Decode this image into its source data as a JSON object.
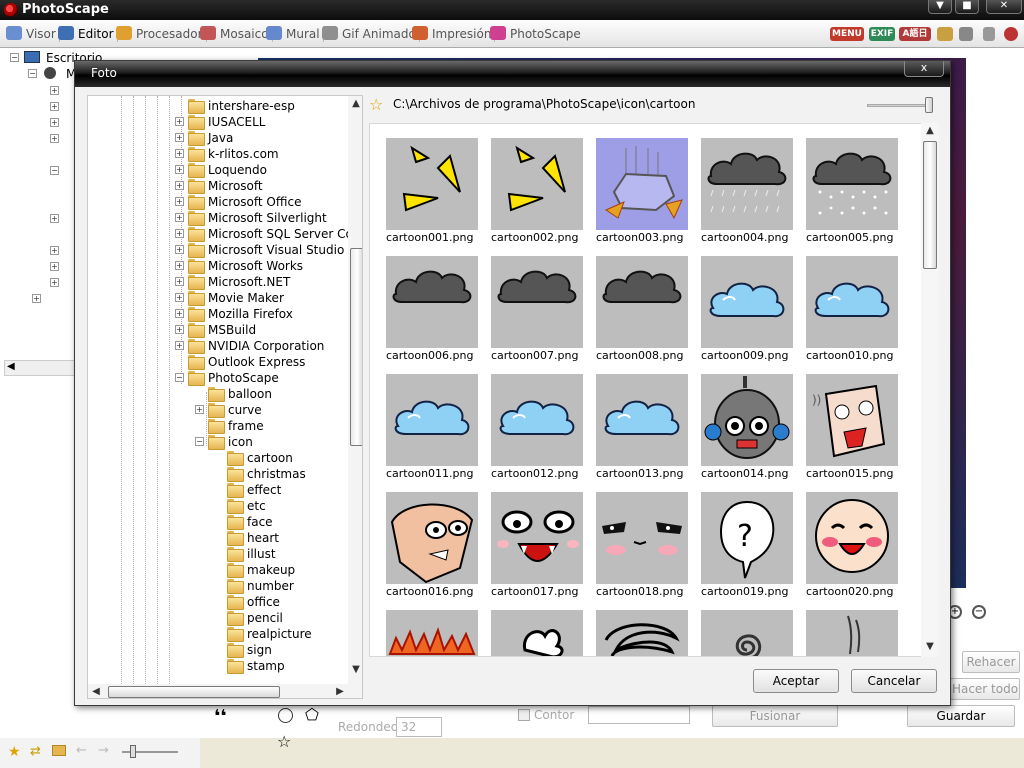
{
  "app": {
    "title": "PhotoScape",
    "window_buttons": [
      "▼",
      "■",
      "✕"
    ]
  },
  "tabs": [
    {
      "label": "Visor",
      "color": "#6a8fd0"
    },
    {
      "label": "Editor",
      "color": "#3e6fb3",
      "active": true
    },
    {
      "label": "Procesador",
      "color": "#e0a030"
    },
    {
      "label": "Mosaico",
      "color": "#c25555"
    },
    {
      "label": "Mural",
      "color": "#6688cc"
    },
    {
      "label": "Gif Animado",
      "color": "#8f8f8f"
    },
    {
      "label": "Impresión",
      "color": "#d06030"
    },
    {
      "label": "PhotoScape",
      "color": "#d04090"
    }
  ],
  "toolbar_icons": [
    "MENU",
    "EXIF",
    "A語日"
  ],
  "main_tree": {
    "root_label": "Escritorio",
    "child_label": "M"
  },
  "background": {
    "buttons": [
      "Rehacer",
      "Hacer todo",
      "Fusionar",
      "Guardar"
    ],
    "redondeo_label": "Redondeo",
    "redondeo_value": "32",
    "contorno_label": "Contor"
  },
  "dialog": {
    "title": "Foto",
    "close_label": "x",
    "path": "C:\\Archivos de programa\\PhotoScape\\icon\\cartoon",
    "accept_label": "Aceptar",
    "cancel_label": "Cancelar",
    "folders": [
      {
        "label": "intershare-esp",
        "level": 0,
        "expander": "none"
      },
      {
        "label": "IUSACELL",
        "level": 0,
        "expander": "+"
      },
      {
        "label": "Java",
        "level": 0,
        "expander": "+"
      },
      {
        "label": "k-rlitos.com",
        "level": 0,
        "expander": "+"
      },
      {
        "label": "Loquendo",
        "level": 0,
        "expander": "+"
      },
      {
        "label": "Microsoft",
        "level": 0,
        "expander": "+"
      },
      {
        "label": "Microsoft Office",
        "level": 0,
        "expander": "+"
      },
      {
        "label": "Microsoft Silverlight",
        "level": 0,
        "expander": "+"
      },
      {
        "label": "Microsoft SQL Server Com",
        "level": 0,
        "expander": "+"
      },
      {
        "label": "Microsoft Visual Studio",
        "level": 0,
        "expander": "+"
      },
      {
        "label": "Microsoft Works",
        "level": 0,
        "expander": "+"
      },
      {
        "label": "Microsoft.NET",
        "level": 0,
        "expander": "+"
      },
      {
        "label": "Movie Maker",
        "level": 0,
        "expander": "+"
      },
      {
        "label": "Mozilla Firefox",
        "level": 0,
        "expander": "+"
      },
      {
        "label": "MSBuild",
        "level": 0,
        "expander": "+"
      },
      {
        "label": "NVIDIA Corporation",
        "level": 0,
        "expander": "+"
      },
      {
        "label": "Outlook Express",
        "level": 0,
        "expander": "none"
      },
      {
        "label": "PhotoScape",
        "level": 0,
        "expander": "-"
      },
      {
        "label": "balloon",
        "level": 1,
        "expander": "none"
      },
      {
        "label": "curve",
        "level": 1,
        "expander": "+"
      },
      {
        "label": "frame",
        "level": 1,
        "expander": "none"
      },
      {
        "label": "icon",
        "level": 1,
        "expander": "-"
      },
      {
        "label": "cartoon",
        "level": 2,
        "expander": "none"
      },
      {
        "label": "christmas",
        "level": 2,
        "expander": "none"
      },
      {
        "label": "effect",
        "level": 2,
        "expander": "none"
      },
      {
        "label": "etc",
        "level": 2,
        "expander": "none"
      },
      {
        "label": "face",
        "level": 2,
        "expander": "none"
      },
      {
        "label": "heart",
        "level": 2,
        "expander": "none"
      },
      {
        "label": "illust",
        "level": 2,
        "expander": "none"
      },
      {
        "label": "makeup",
        "level": 2,
        "expander": "none"
      },
      {
        "label": "number",
        "level": 2,
        "expander": "none"
      },
      {
        "label": "office",
        "level": 2,
        "expander": "none"
      },
      {
        "label": "pencil",
        "level": 2,
        "expander": "none"
      },
      {
        "label": "realpicture",
        "level": 2,
        "expander": "none"
      },
      {
        "label": "sign",
        "level": 2,
        "expander": "none"
      },
      {
        "label": "stamp",
        "level": 2,
        "expander": "none"
      }
    ],
    "files": [
      {
        "name": "cartoon001.png",
        "art": "yellow-shards"
      },
      {
        "name": "cartoon002.png",
        "art": "yellow-shards"
      },
      {
        "name": "cartoon003.png",
        "art": "purple-rock",
        "selected": true
      },
      {
        "name": "cartoon004.png",
        "art": "rain-cloud"
      },
      {
        "name": "cartoon005.png",
        "art": "snow-cloud"
      },
      {
        "name": "cartoon006.png",
        "art": "grey-cloud"
      },
      {
        "name": "cartoon007.png",
        "art": "grey-cloud"
      },
      {
        "name": "cartoon008.png",
        "art": "grey-cloud"
      },
      {
        "name": "cartoon009.png",
        "art": "blue-cloud"
      },
      {
        "name": "cartoon010.png",
        "art": "blue-cloud"
      },
      {
        "name": "cartoon011.png",
        "art": "blue-cloud"
      },
      {
        "name": "cartoon012.png",
        "art": "blue-cloud"
      },
      {
        "name": "cartoon013.png",
        "art": "blue-cloud"
      },
      {
        "name": "cartoon014.png",
        "art": "robot"
      },
      {
        "name": "cartoon015.png",
        "art": "scared-face"
      },
      {
        "name": "cartoon016.png",
        "art": "angry-face"
      },
      {
        "name": "cartoon017.png",
        "art": "shout-face"
      },
      {
        "name": "cartoon018.png",
        "art": "blush-eyes"
      },
      {
        "name": "cartoon019.png",
        "art": "question-bubble"
      },
      {
        "name": "cartoon020.png",
        "art": "laugh-face"
      },
      {
        "name": "",
        "art": "fire"
      },
      {
        "name": "",
        "art": "white-blob"
      },
      {
        "name": "",
        "art": "scribble"
      },
      {
        "name": "",
        "art": "spiral"
      },
      {
        "name": "",
        "art": "lines"
      }
    ]
  }
}
